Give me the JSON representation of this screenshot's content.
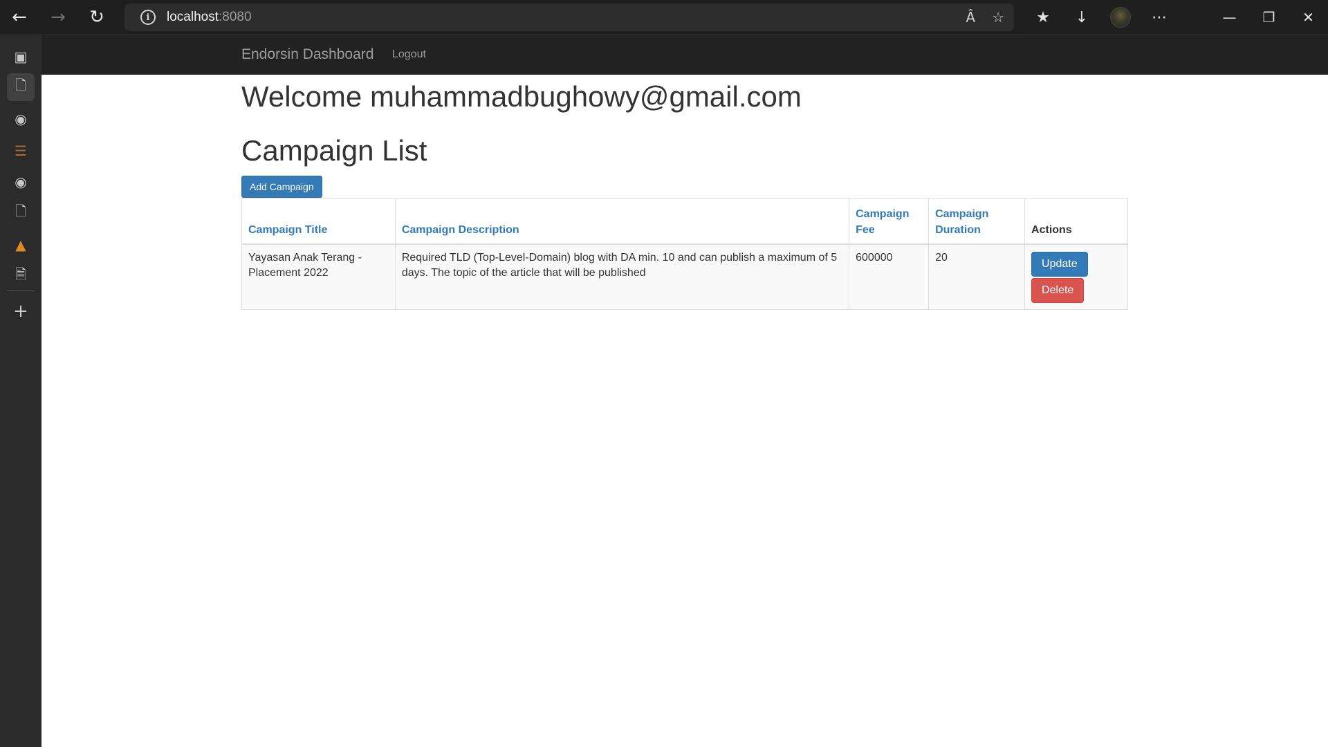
{
  "browser": {
    "url_host": "localhost",
    "url_port": ":8080"
  },
  "navbar": {
    "brand": "Endorsin Dashboard",
    "logout_label": "Logout"
  },
  "main": {
    "welcome": "Welcome muhammadbughowy@gmail.com",
    "list_title": "Campaign List",
    "add_button": "Add Campaign"
  },
  "table": {
    "headers": {
      "title": "Campaign Title",
      "description": "Campaign Description",
      "fee": "Campaign Fee",
      "duration": "Campaign Duration",
      "actions": "Actions"
    },
    "rows": [
      {
        "title": "Yayasan Anak Terang - Placement 2022",
        "description": "Required TLD (Top-Level-Domain) blog with DA min. 10 and can publish a maximum of 5 days. The topic of the article that will be published",
        "fee": "600000",
        "duration": "20",
        "update_label": "Update",
        "delete_label": "Delete"
      }
    ]
  },
  "colors": {
    "navbar_bg": "#222222",
    "primary": "#337ab7",
    "danger": "#d9534f",
    "link": "#337ab7"
  }
}
